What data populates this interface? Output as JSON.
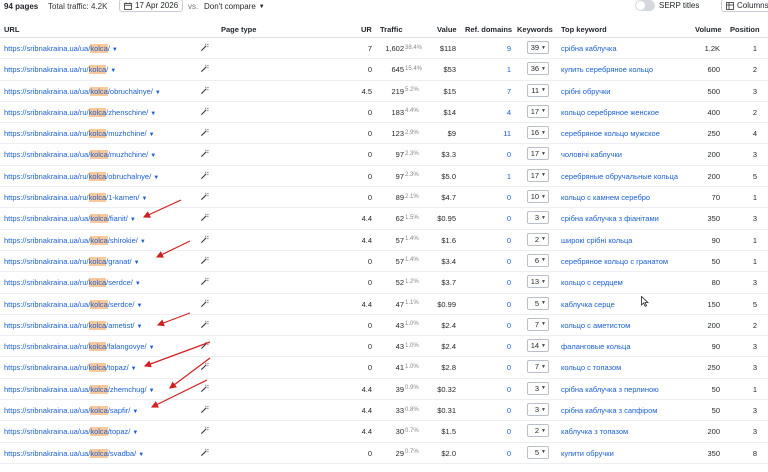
{
  "topbar": {
    "pages": "94 pages",
    "traffic": "Total traffic: 4.2K",
    "date": "17 Apr 2026",
    "vs": "vs.",
    "compare": "Don't compare",
    "serp_titles": "SERP titles",
    "columns": "Columns"
  },
  "header": {
    "url": "URL",
    "page_type": "Page type",
    "ur": "UR",
    "traffic": "Traffic",
    "value": "Value",
    "ref_domains": "Ref. domains",
    "keywords": "Keywords",
    "top_keyword": "Top keyword",
    "volume": "Volume",
    "position": "Position"
  },
  "rows": [
    {
      "pre": "https://sribnakraina.ua/ua/",
      "hl": "kolca",
      "post": "/",
      "ur": "7",
      "traffic": "1,602",
      "pct": "38.4%",
      "value": "$118",
      "ref": "9",
      "kw": "39",
      "top": "срібна каблучка",
      "vol": "1.2K",
      "pos": "1"
    },
    {
      "pre": "https://sribnakraina.ua/ru/",
      "hl": "kolca",
      "post": "/",
      "ur": "0",
      "traffic": "645",
      "pct": "15.4%",
      "value": "$53",
      "ref": "1",
      "kw": "36",
      "top": "купить серебряное кольцо",
      "vol": "600",
      "pos": "2"
    },
    {
      "pre": "https://sribnakraina.ua/ua/",
      "hl": "kolca",
      "post": "/obruchalnye/",
      "ur": "4.5",
      "traffic": "219",
      "pct": "5.2%",
      "value": "$15",
      "ref": "7",
      "kw": "11",
      "top": "срібні обручки",
      "vol": "500",
      "pos": "3"
    },
    {
      "pre": "https://sribnakraina.ua/ru/",
      "hl": "kolca",
      "post": "/zhenschine/",
      "ur": "0",
      "traffic": "183",
      "pct": "4.4%",
      "value": "$14",
      "ref": "4",
      "kw": "17",
      "top": "кольцо серебряное женское",
      "vol": "400",
      "pos": "2"
    },
    {
      "pre": "https://sribnakraina.ua/ru/",
      "hl": "kolca",
      "post": "/muzhchine/",
      "ur": "0",
      "traffic": "123",
      "pct": "2.9%",
      "value": "$9",
      "ref": "11",
      "kw": "16",
      "top": "серебряное кольцо мужское",
      "vol": "250",
      "pos": "4"
    },
    {
      "pre": "https://sribnakraina.ua/ua/",
      "hl": "kolca",
      "post": "/muzhchine/",
      "ur": "0",
      "traffic": "97",
      "pct": "2.3%",
      "value": "$3.3",
      "ref": "0",
      "kw": "17",
      "top": "чоловічі каблучки",
      "vol": "200",
      "pos": "3"
    },
    {
      "pre": "https://sribnakraina.ua/ru/",
      "hl": "kolca",
      "post": "/obruchalnye/",
      "ur": "0",
      "traffic": "97",
      "pct": "2.3%",
      "value": "$5.0",
      "ref": "1",
      "kw": "17",
      "top": "серебряные обручальные кольца",
      "vol": "200",
      "pos": "5"
    },
    {
      "pre": "https://sribnakraina.ua/ru/",
      "hl": "kolca",
      "post": "/1-kamen/",
      "ur": "0",
      "traffic": "89",
      "pct": "2.1%",
      "value": "$4.7",
      "ref": "0",
      "kw": "10",
      "top": "кольцо с камнем серебро",
      "vol": "70",
      "pos": "1"
    },
    {
      "pre": "https://sribnakraina.ua/ua/",
      "hl": "kolca",
      "post": "/fianit/",
      "ur": "4.4",
      "traffic": "62",
      "pct": "1.5%",
      "value": "$0.95",
      "ref": "0",
      "kw": "3",
      "top": "срібна каблучка з фіанітами",
      "vol": "350",
      "pos": "3"
    },
    {
      "pre": "https://sribnakraina.ua/ua/",
      "hl": "kolca",
      "post": "/shirokie/",
      "ur": "4.4",
      "traffic": "57",
      "pct": "1.4%",
      "value": "$1.6",
      "ref": "0",
      "kw": "2",
      "top": "широкі срібні кольца",
      "vol": "90",
      "pos": "1"
    },
    {
      "pre": "https://sribnakraina.ua/ru/",
      "hl": "kolca",
      "post": "/granat/",
      "ur": "0",
      "traffic": "57",
      "pct": "1.4%",
      "value": "$3.4",
      "ref": "0",
      "kw": "6",
      "top": "серебряное кольцо с гранатом",
      "vol": "50",
      "pos": "1"
    },
    {
      "pre": "https://sribnakraina.ua/ru/",
      "hl": "kolca",
      "post": "/serdce/",
      "ur": "0",
      "traffic": "52",
      "pct": "1.2%",
      "value": "$3.7",
      "ref": "0",
      "kw": "13",
      "top": "кольцо с сердцем",
      "vol": "80",
      "pos": "3"
    },
    {
      "pre": "https://sribnakraina.ua/ua/",
      "hl": "kolca",
      "post": "/serdce/",
      "ur": "4.4",
      "traffic": "47",
      "pct": "1.1%",
      "value": "$0.99",
      "ref": "0",
      "kw": "5",
      "top": "каблучка серце",
      "vol": "150",
      "pos": "5"
    },
    {
      "pre": "https://sribnakraina.ua/ru/",
      "hl": "kolca",
      "post": "/ametist/",
      "ur": "0",
      "traffic": "43",
      "pct": "1.0%",
      "value": "$2.4",
      "ref": "0",
      "kw": "7",
      "top": "кольцо с аметистом",
      "vol": "200",
      "pos": "2"
    },
    {
      "pre": "https://sribnakraina.ua/ru/",
      "hl": "kolca",
      "post": "/falangovye/",
      "ur": "0",
      "traffic": "43",
      "pct": "1.0%",
      "value": "$2.4",
      "ref": "0",
      "kw": "14",
      "top": "фаланговые кольца",
      "vol": "90",
      "pos": "3"
    },
    {
      "pre": "https://sribnakraina.ua/ru/",
      "hl": "kolca",
      "post": "/topaz/",
      "ur": "0",
      "traffic": "41",
      "pct": "1.0%",
      "value": "$2.8",
      "ref": "0",
      "kw": "7",
      "top": "кольцо с топазом",
      "vol": "250",
      "pos": "3"
    },
    {
      "pre": "https://sribnakraina.ua/ua/",
      "hl": "kolca",
      "post": "/zhemchug/",
      "ur": "4.4",
      "traffic": "39",
      "pct": "0.9%",
      "value": "$0.32",
      "ref": "0",
      "kw": "3",
      "top": "срібна каблучка з перлиною",
      "vol": "50",
      "pos": "1"
    },
    {
      "pre": "https://sribnakraina.ua/ua/",
      "hl": "kolca",
      "post": "/sapfir/",
      "ur": "4.4",
      "traffic": "33",
      "pct": "0.8%",
      "value": "$0.31",
      "ref": "0",
      "kw": "3",
      "top": "срібна каблучка з сапфіром",
      "vol": "50",
      "pos": "3"
    },
    {
      "pre": "https://sribnakraina.ua/ua/",
      "hl": "kolca",
      "post": "/topaz/",
      "ur": "4.4",
      "traffic": "30",
      "pct": "0.7%",
      "value": "$1.5",
      "ref": "0",
      "kw": "2",
      "top": "каблучка з топазом",
      "vol": "200",
      "pos": "3"
    },
    {
      "pre": "https://sribnakraina.ua/ua/",
      "hl": "kolca",
      "post": "/svadba/",
      "ur": "0",
      "traffic": "29",
      "pct": "0.7%",
      "value": "$2.0",
      "ref": "0",
      "kw": "5",
      "top": "купити обручки",
      "vol": "350",
      "pos": "8"
    }
  ],
  "colors": {
    "link": "#1a5fd1",
    "highlight": "#f9c89b",
    "arrow": "#d0201f"
  },
  "icons": {
    "calendar": "calendar-icon",
    "columns": "columns-icon",
    "page_type": "magic-wand-icon",
    "dropdown": "chevron-down-icon",
    "cursor": "mouse-pointer-icon"
  }
}
